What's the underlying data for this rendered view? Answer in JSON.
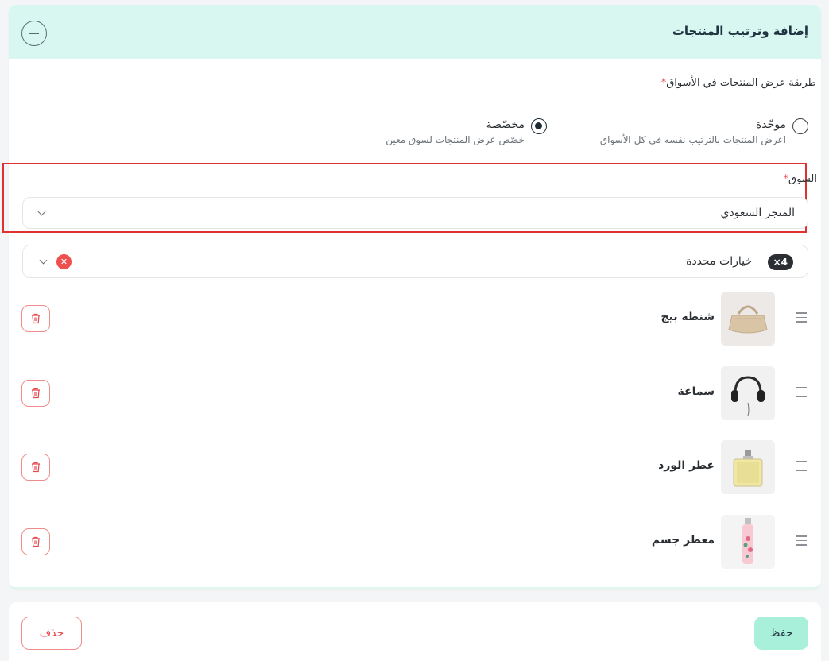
{
  "header": {
    "title": "إضافة وترتيب المنتجات"
  },
  "display_method": {
    "label": "طريقة عرض المنتجات في الأسواق",
    "required_mark": "*",
    "options": [
      {
        "title": "موحّدة",
        "description": "اعرض المنتجات بالترتيب نفسه في كل الأسواق",
        "selected": false
      },
      {
        "title": "مخصّصة",
        "description": "خصّص عرض المنتجات لسوق معين",
        "selected": true
      }
    ]
  },
  "market": {
    "label": "السوق",
    "required_mark": "*",
    "selected_value": "المتجر السعودي"
  },
  "products_select": {
    "count_badge": "×4",
    "text": "خيارات محددة"
  },
  "products": [
    {
      "name": "شنطة بيج",
      "thumbnail": "beige-bag"
    },
    {
      "name": "سماعة",
      "thumbnail": "headphones"
    },
    {
      "name": "عطر الورد",
      "thumbnail": "perfume-bottle"
    },
    {
      "name": "معطر جسم",
      "thumbnail": "body-mist"
    }
  ],
  "footer": {
    "save_label": "حفظ",
    "delete_label": "حذف"
  },
  "colors": {
    "header_bg": "#d8f7f1",
    "accent": "#a8f0d9",
    "danger": "#e5484d",
    "highlight_border": "#e03131"
  }
}
